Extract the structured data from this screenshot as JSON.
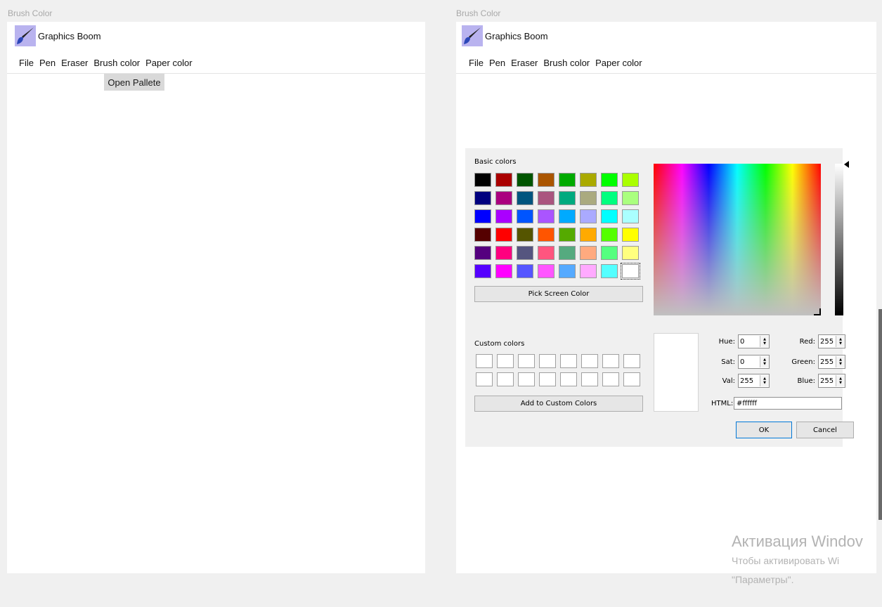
{
  "left": {
    "frame_title": "Brush Color",
    "app_name": "Graphics Boom",
    "menu": [
      "File",
      "Pen",
      "Eraser",
      "Brush color",
      "Paper color"
    ],
    "dropdown_item": "Open Pallete"
  },
  "right": {
    "frame_title": "Brush Color",
    "app_name": "Graphics Boom",
    "menu": [
      "File",
      "Pen",
      "Eraser",
      "Brush color",
      "Paper color"
    ]
  },
  "dialog": {
    "basic_colors_label": "Basic colors",
    "basic_colors": [
      "#000000",
      "#aa0000",
      "#005500",
      "#aa5500",
      "#00aa00",
      "#aaaa00",
      "#00ff00",
      "#aaff00",
      "#00007f",
      "#aa007f",
      "#00557f",
      "#aa557f",
      "#00aa7f",
      "#aaaa7f",
      "#00ff7f",
      "#aaff7f",
      "#0000ff",
      "#aa00ff",
      "#0055ff",
      "#aa55ff",
      "#00aaff",
      "#aaaaff",
      "#00ffff",
      "#aaffff",
      "#550000",
      "#ff0000",
      "#555500",
      "#ff5500",
      "#55aa00",
      "#ffaa00",
      "#55ff00",
      "#ffff00",
      "#55007f",
      "#ff007f",
      "#55557f",
      "#ff557f",
      "#55aa7f",
      "#ffaa7f",
      "#55ff7f",
      "#ffff7f",
      "#5500ff",
      "#ff00ff",
      "#5555ff",
      "#ff55ff",
      "#55aaff",
      "#ffaaff",
      "#55ffff",
      "#ffffff"
    ],
    "pick_screen_label": "Pick Screen Color",
    "custom_colors_label": "Custom colors",
    "add_custom_label": "Add to Custom Colors",
    "hue_label": "Hue:",
    "hue": "0",
    "sat_label": "Sat:",
    "sat": "0",
    "val_label": "Val:",
    "val": "255",
    "red_label": "Red:",
    "red": "255",
    "green_label": "Green:",
    "green": "255",
    "blue_label": "Blue:",
    "blue": "255",
    "html_label": "HTML:",
    "html": "#ffffff",
    "ok_label": "OK",
    "cancel_label": "Cancel",
    "current_color": "#ffffff"
  },
  "watermark": {
    "line1": "Активация Windov",
    "line2": "Чтобы активировать Wi",
    "line3": "\"Параметры\"."
  }
}
